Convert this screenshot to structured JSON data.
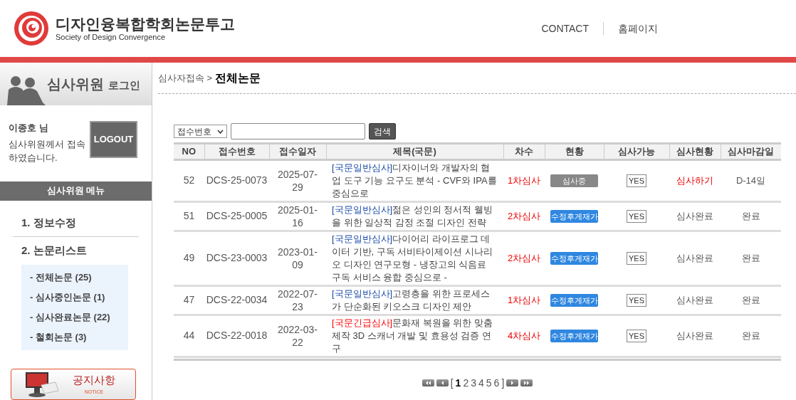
{
  "header": {
    "title": "디자인융복합학회논문투고",
    "subtitle": "Society of Design Convergence",
    "links": [
      "CONTACT",
      "홈페이지"
    ]
  },
  "sidebar": {
    "login_title": "심사위원",
    "login_suffix": "로그인",
    "user_name": "이종호 님",
    "welcome": "심사위원께서 접속하였습니다.",
    "logout": "LOGOUT",
    "menu_title": "심사위원 메뉴",
    "menu": [
      {
        "label": "1. 정보수정"
      },
      {
        "label": "2. 논문리스트",
        "children": [
          {
            "label": "- 전체논문 (25)"
          },
          {
            "label": "- 심사중인논문 (1)"
          },
          {
            "label": "- 심사완료논문 (22)"
          },
          {
            "label": "- 철회논문 (3)"
          }
        ]
      }
    ],
    "notice": {
      "title": "공지사항",
      "subtitle": "NOTICE"
    }
  },
  "breadcrumb": {
    "parent": "심사자접속 >",
    "current": "전체논문"
  },
  "search": {
    "select": "접수번호",
    "button": "검색"
  },
  "table": {
    "columns": [
      "NO",
      "접수번호",
      "접수일자",
      "제목(국문)",
      "차수",
      "현황",
      "심사가능",
      "심사현황",
      "심사마감일"
    ],
    "rows": [
      {
        "no": "52",
        "code": "DCS-25-0073",
        "date": "2025-07-29",
        "prefix": "[국문일반심사]",
        "urgent": false,
        "title": "디자이너와 개발자의 협업 도구 기능 요구도 분석 - CVF와 IPA를 중심으로",
        "round": "1차심사",
        "status": "심사중",
        "in_review": true,
        "available": "YES",
        "review": "심사하기",
        "review_pending": true,
        "deadline": "D-14일"
      },
      {
        "no": "51",
        "code": "DCS-25-0005",
        "date": "2025-01-16",
        "prefix": "[국문일반심사]",
        "urgent": false,
        "title": "젊은 성인의 정서적 웰빙을 위한 일상적 감정 조절 디자인 전략",
        "round": "2차심사",
        "status": "수정후게재가",
        "in_review": false,
        "available": "YES",
        "review": "심사완료",
        "review_pending": false,
        "deadline": "완료"
      },
      {
        "no": "49",
        "code": "DCS-23-0003",
        "date": "2023-01-09",
        "prefix": "[국문일반심사]",
        "urgent": false,
        "title": "다이어리 라이프로그 데이터 기반, 구독 서비타이제이션 시나리오 디자인 연구모형 - 냉장고의 식음료 구독 서비스 융합 중심으로 -",
        "round": "2차심사",
        "status": "수정후게재가",
        "in_review": false,
        "available": "YES",
        "review": "심사완료",
        "review_pending": false,
        "deadline": "완료"
      },
      {
        "no": "47",
        "code": "DCS-22-0034",
        "date": "2022-07-23",
        "prefix": "[국문일반심사]",
        "urgent": false,
        "title": "고령층을 위한 프로세스가 단순화된 키오스크 디자인 제안",
        "round": "1차심사",
        "status": "수정후게재가",
        "in_review": false,
        "available": "YES",
        "review": "심사완료",
        "review_pending": false,
        "deadline": "완료"
      },
      {
        "no": "44",
        "code": "DCS-22-0018",
        "date": "2022-03-22",
        "prefix": "[국문긴급심사]",
        "urgent": true,
        "title": "문화재 복원을 위한 맞춤 제작 3D 스캐너 개발 및 효용성 검증 연구",
        "round": "4차심사",
        "status": "수정후게재가",
        "in_review": false,
        "available": "YES",
        "review": "심사완료",
        "review_pending": false,
        "deadline": "완료"
      }
    ]
  },
  "pagination": {
    "open": "[",
    "close": "]",
    "pages": [
      {
        "label": "1",
        "selected": true
      },
      {
        "label": "2",
        "selected": false
      },
      {
        "label": "3",
        "selected": false
      },
      {
        "label": "4",
        "selected": false
      },
      {
        "label": "5",
        "selected": false
      },
      {
        "label": "6",
        "selected": false
      }
    ]
  }
}
